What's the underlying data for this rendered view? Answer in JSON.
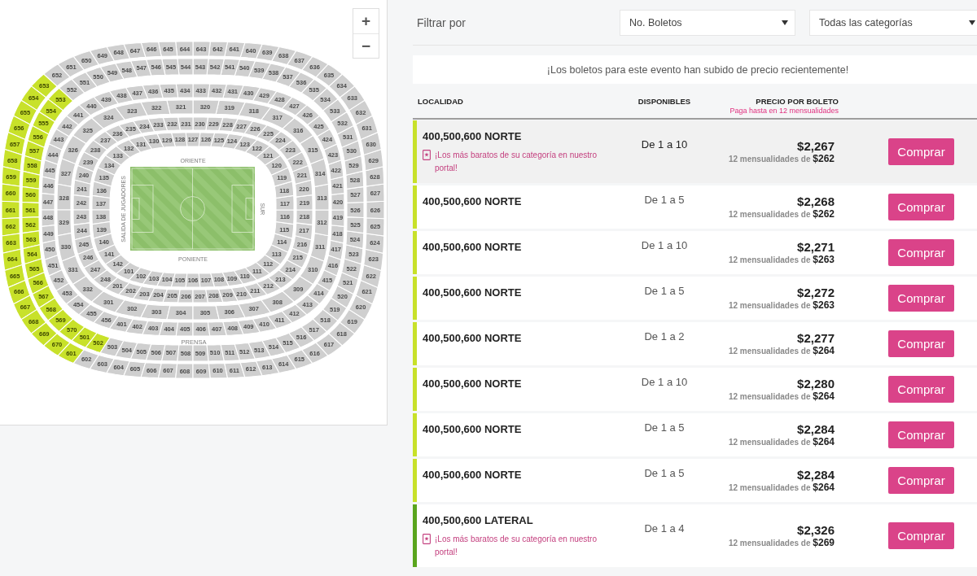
{
  "map": {
    "zoom_controls": [
      "+",
      "−"
    ],
    "stand_labels": [
      {
        "kind": "top",
        "text": "ORIENTE"
      },
      {
        "kind": "bottom",
        "text": "PONIENTE"
      },
      {
        "kind": "left",
        "text": "SALIDA DE JUGADORES"
      },
      {
        "kind": "right",
        "text": "SUR"
      },
      {
        "kind": "press",
        "text": "PRENSA"
      }
    ],
    "rings": [
      {
        "stands": [
          {
            "kind": "top",
            "sections": [
              {
                "label": "132",
                "highlighted": false
              },
              {
                "label": "131",
                "highlighted": false
              },
              {
                "label": "130",
                "highlighted": false
              },
              {
                "label": "129",
                "highlighted": false
              },
              {
                "label": "128",
                "highlighted": false
              },
              {
                "label": "127",
                "highlighted": false
              },
              {
                "label": "126",
                "highlighted": false
              },
              {
                "label": "125",
                "highlighted": false
              },
              {
                "label": "124",
                "highlighted": false
              },
              {
                "label": "123",
                "highlighted": false
              },
              {
                "label": "122",
                "highlighted": false
              }
            ]
          },
          {
            "kind": "left",
            "sections": [
              {
                "label": "133",
                "highlighted": false
              },
              {
                "label": "134",
                "highlighted": false
              },
              {
                "label": "135",
                "highlighted": false
              },
              {
                "label": "136",
                "highlighted": false
              },
              {
                "label": "137",
                "highlighted": false
              },
              {
                "label": "138",
                "highlighted": false
              },
              {
                "label": "139",
                "highlighted": false
              },
              {
                "label": "140",
                "highlighted": false
              },
              {
                "label": "141",
                "highlighted": false
              },
              {
                "label": "142",
                "highlighted": false
              }
            ]
          },
          {
            "kind": "right",
            "sections": [
              {
                "label": "121",
                "highlighted": false
              },
              {
                "label": "120",
                "highlighted": false
              },
              {
                "label": "119",
                "highlighted": false
              },
              {
                "label": "118",
                "highlighted": false
              },
              {
                "label": "117",
                "highlighted": false
              },
              {
                "label": "116",
                "highlighted": false
              },
              {
                "label": "115",
                "highlighted": false
              },
              {
                "label": "114",
                "highlighted": false
              },
              {
                "label": "113",
                "highlighted": false
              },
              {
                "label": "112",
                "highlighted": false
              }
            ]
          },
          {
            "kind": "bottom",
            "sections": [
              {
                "label": "101",
                "highlighted": false
              },
              {
                "label": "102",
                "highlighted": false
              },
              {
                "label": "103",
                "highlighted": false
              },
              {
                "label": "104",
                "highlighted": false
              },
              {
                "label": "105",
                "highlighted": false
              },
              {
                "label": "106",
                "highlighted": false
              },
              {
                "label": "107",
                "highlighted": false
              },
              {
                "label": "108",
                "highlighted": false
              },
              {
                "label": "109",
                "highlighted": false
              },
              {
                "label": "110",
                "highlighted": false
              },
              {
                "label": "111",
                "highlighted": false
              }
            ]
          }
        ]
      },
      {
        "stands": [
          {
            "kind": "top",
            "sections": [
              {
                "label": "238",
                "highlighted": false
              },
              {
                "label": "237",
                "highlighted": false
              },
              {
                "label": "236",
                "highlighted": false
              },
              {
                "label": "235",
                "highlighted": false
              },
              {
                "label": "234",
                "highlighted": false
              },
              {
                "label": "233",
                "highlighted": false
              },
              {
                "label": "232",
                "highlighted": false
              },
              {
                "label": "231",
                "highlighted": false
              },
              {
                "label": "230",
                "highlighted": false
              },
              {
                "label": "229",
                "highlighted": false
              },
              {
                "label": "228",
                "highlighted": false
              },
              {
                "label": "227",
                "highlighted": false
              },
              {
                "label": "226",
                "highlighted": false
              },
              {
                "label": "225",
                "highlighted": false
              },
              {
                "label": "224",
                "highlighted": false
              },
              {
                "label": "223",
                "highlighted": false
              }
            ]
          },
          {
            "kind": "left",
            "sections": [
              {
                "label": "239",
                "highlighted": false
              },
              {
                "label": "240",
                "highlighted": false
              },
              {
                "label": "241",
                "highlighted": false
              },
              {
                "label": "242",
                "highlighted": false
              },
              {
                "label": "243",
                "highlighted": false
              },
              {
                "label": "244",
                "highlighted": false
              },
              {
                "label": "245",
                "highlighted": false
              },
              {
                "label": "246",
                "highlighted": false
              },
              {
                "label": "247",
                "highlighted": false
              },
              {
                "label": "248",
                "highlighted": false
              }
            ]
          },
          {
            "kind": "right",
            "sections": [
              {
                "label": "222",
                "highlighted": false
              },
              {
                "label": "221",
                "highlighted": false
              },
              {
                "label": "220",
                "highlighted": false
              },
              {
                "label": "219",
                "highlighted": false
              },
              {
                "label": "218",
                "highlighted": false
              },
              {
                "label": "217",
                "highlighted": false
              },
              {
                "label": "216",
                "highlighted": false
              },
              {
                "label": "215",
                "highlighted": false
              },
              {
                "label": "214",
                "highlighted": false
              },
              {
                "label": "213",
                "highlighted": false
              }
            ]
          },
          {
            "kind": "bottom",
            "sections": [
              {
                "label": "201",
                "highlighted": false
              },
              {
                "label": "202",
                "highlighted": false
              },
              {
                "label": "203",
                "highlighted": false
              },
              {
                "label": "204",
                "highlighted": false
              },
              {
                "label": "205",
                "highlighted": false
              },
              {
                "label": "206",
                "highlighted": false
              },
              {
                "label": "207",
                "highlighted": false
              },
              {
                "label": "208",
                "highlighted": false
              },
              {
                "label": "209",
                "highlighted": false
              },
              {
                "label": "210",
                "highlighted": false
              },
              {
                "label": "211",
                "highlighted": false
              },
              {
                "label": "212",
                "highlighted": false
              }
            ]
          }
        ]
      },
      {
        "stands": [
          {
            "kind": "top",
            "sections": [
              {
                "label": "325",
                "highlighted": false
              },
              {
                "label": "324",
                "highlighted": false
              },
              {
                "label": "323",
                "highlighted": false
              },
              {
                "label": "322",
                "highlighted": false
              },
              {
                "label": "321",
                "highlighted": false
              },
              {
                "label": "320",
                "highlighted": false
              },
              {
                "label": "319",
                "highlighted": false
              },
              {
                "label": "318",
                "highlighted": false
              },
              {
                "label": "317",
                "highlighted": false
              }
            ]
          },
          {
            "kind": "left",
            "sections": [
              {
                "label": "326",
                "highlighted": false
              },
              {
                "label": "327",
                "highlighted": false
              },
              {
                "label": "328",
                "highlighted": false
              },
              {
                "label": "329",
                "highlighted": false
              },
              {
                "label": "330",
                "highlighted": false
              },
              {
                "label": "331",
                "highlighted": false
              },
              {
                "label": "332",
                "highlighted": false
              }
            ]
          },
          {
            "kind": "right",
            "sections": [
              {
                "label": "316",
                "highlighted": false
              },
              {
                "label": "315",
                "highlighted": false
              },
              {
                "label": "314",
                "highlighted": false
              },
              {
                "label": "313",
                "highlighted": false
              },
              {
                "label": "312",
                "highlighted": false
              },
              {
                "label": "311",
                "highlighted": false
              },
              {
                "label": "310",
                "highlighted": false
              },
              {
                "label": "309",
                "highlighted": false
              }
            ]
          },
          {
            "kind": "bottom",
            "sections": [
              {
                "label": "301",
                "highlighted": false
              },
              {
                "label": "302",
                "highlighted": false
              },
              {
                "label": "303",
                "highlighted": false
              },
              {
                "label": "304",
                "highlighted": false
              },
              {
                "label": "305",
                "highlighted": false
              },
              {
                "label": "306",
                "highlighted": false
              },
              {
                "label": "307",
                "highlighted": false
              },
              {
                "label": "308",
                "highlighted": false
              }
            ]
          }
        ]
      },
      {
        "stands": [
          {
            "kind": "top",
            "sections": [
              {
                "label": "444",
                "highlighted": false
              },
              {
                "label": "443",
                "highlighted": false
              },
              {
                "label": "442",
                "highlighted": false
              },
              {
                "label": "441",
                "highlighted": false
              },
              {
                "label": "440",
                "highlighted": false
              },
              {
                "label": "439",
                "highlighted": false
              },
              {
                "label": "438",
                "highlighted": false
              },
              {
                "label": "437",
                "highlighted": false
              },
              {
                "label": "436",
                "highlighted": false
              },
              {
                "label": "435",
                "highlighted": false
              },
              {
                "label": "434",
                "highlighted": false
              },
              {
                "label": "433",
                "highlighted": false
              },
              {
                "label": "432",
                "highlighted": false
              },
              {
                "label": "431",
                "highlighted": false
              },
              {
                "label": "430",
                "highlighted": false
              },
              {
                "label": "429",
                "highlighted": false
              },
              {
                "label": "428",
                "highlighted": false
              },
              {
                "label": "427",
                "highlighted": false
              }
            ]
          },
          {
            "kind": "left",
            "sections": [
              {
                "label": "445",
                "highlighted": false
              },
              {
                "label": "446",
                "highlighted": false
              },
              {
                "label": "447",
                "highlighted": false
              },
              {
                "label": "448",
                "highlighted": false
              },
              {
                "label": "449",
                "highlighted": false
              },
              {
                "label": "450",
                "highlighted": false
              },
              {
                "label": "451",
                "highlighted": false
              },
              {
                "label": "452",
                "highlighted": false
              },
              {
                "label": "453",
                "highlighted": false
              },
              {
                "label": "454",
                "highlighted": false
              },
              {
                "label": "455",
                "highlighted": false
              },
              {
                "label": "456",
                "highlighted": false
              }
            ]
          },
          {
            "kind": "right",
            "sections": [
              {
                "label": "426",
                "highlighted": false
              },
              {
                "label": "425",
                "highlighted": false
              },
              {
                "label": "424",
                "highlighted": false
              },
              {
                "label": "423",
                "highlighted": false
              },
              {
                "label": "422",
                "highlighted": false
              },
              {
                "label": "421",
                "highlighted": false
              },
              {
                "label": "420",
                "highlighted": false
              },
              {
                "label": "419",
                "highlighted": false
              },
              {
                "label": "418",
                "highlighted": false
              },
              {
                "label": "417",
                "highlighted": false
              },
              {
                "label": "416",
                "highlighted": false
              },
              {
                "label": "415",
                "highlighted": false
              },
              {
                "label": "414",
                "highlighted": false
              },
              {
                "label": "413",
                "highlighted": false
              },
              {
                "label": "412",
                "highlighted": false
              },
              {
                "label": "411",
                "highlighted": false
              }
            ]
          },
          {
            "kind": "bottom",
            "sections": [
              {
                "label": "401",
                "highlighted": false
              },
              {
                "label": "402",
                "highlighted": false
              },
              {
                "label": "403",
                "highlighted": false
              },
              {
                "label": "404",
                "highlighted": false
              },
              {
                "label": "405",
                "highlighted": false
              },
              {
                "label": "406",
                "highlighted": false
              },
              {
                "label": "407",
                "highlighted": false
              },
              {
                "label": "408",
                "highlighted": false
              },
              {
                "label": "409",
                "highlighted": false
              },
              {
                "label": "410",
                "highlighted": false
              }
            ]
          }
        ]
      },
      {
        "stands": [
          {
            "kind": "top",
            "sections": [
              {
                "label": "552",
                "highlighted": false
              },
              {
                "label": "551",
                "highlighted": false
              },
              {
                "label": "550",
                "highlighted": false
              },
              {
                "label": "549",
                "highlighted": false
              },
              {
                "label": "548",
                "highlighted": false
              },
              {
                "label": "547",
                "highlighted": false
              },
              {
                "label": "546",
                "highlighted": false
              },
              {
                "label": "545",
                "highlighted": false
              },
              {
                "label": "544",
                "highlighted": false
              },
              {
                "label": "543",
                "highlighted": false
              },
              {
                "label": "542",
                "highlighted": false
              },
              {
                "label": "541",
                "highlighted": false
              },
              {
                "label": "540",
                "highlighted": false
              },
              {
                "label": "539",
                "highlighted": false
              },
              {
                "label": "538",
                "highlighted": false
              },
              {
                "label": "537",
                "highlighted": false
              }
            ]
          },
          {
            "kind": "left",
            "sections": [
              {
                "label": "553",
                "highlighted": true
              },
              {
                "label": "554",
                "highlighted": true
              },
              {
                "label": "555",
                "highlighted": true
              },
              {
                "label": "556",
                "highlighted": true
              },
              {
                "label": "557",
                "highlighted": true
              },
              {
                "label": "558",
                "highlighted": true
              },
              {
                "label": "559",
                "highlighted": true
              },
              {
                "label": "560",
                "highlighted": true
              },
              {
                "label": "561",
                "highlighted": true
              },
              {
                "label": "562",
                "highlighted": true
              },
              {
                "label": "563",
                "highlighted": true
              },
              {
                "label": "564",
                "highlighted": true
              },
              {
                "label": "565",
                "highlighted": true
              },
              {
                "label": "566",
                "highlighted": true
              },
              {
                "label": "567",
                "highlighted": true
              },
              {
                "label": "568",
                "highlighted": true
              },
              {
                "label": "569",
                "highlighted": true
              },
              {
                "label": "570",
                "highlighted": true
              }
            ]
          },
          {
            "kind": "right",
            "sections": [
              {
                "label": "536",
                "highlighted": false
              },
              {
                "label": "535",
                "highlighted": false
              },
              {
                "label": "534",
                "highlighted": false
              },
              {
                "label": "533",
                "highlighted": false
              },
              {
                "label": "532",
                "highlighted": false
              },
              {
                "label": "531",
                "highlighted": false
              },
              {
                "label": "530",
                "highlighted": false
              },
              {
                "label": "529",
                "highlighted": false
              },
              {
                "label": "528",
                "highlighted": false
              },
              {
                "label": "527",
                "highlighted": false
              },
              {
                "label": "526",
                "highlighted": false
              },
              {
                "label": "525",
                "highlighted": false
              },
              {
                "label": "524",
                "highlighted": false
              },
              {
                "label": "523",
                "highlighted": false
              },
              {
                "label": "522",
                "highlighted": false
              },
              {
                "label": "521",
                "highlighted": false
              },
              {
                "label": "520",
                "highlighted": false
              },
              {
                "label": "519",
                "highlighted": false
              },
              {
                "label": "518",
                "highlighted": false
              },
              {
                "label": "517",
                "highlighted": false
              }
            ]
          },
          {
            "kind": "bottom",
            "sections": [
              {
                "label": "501",
                "highlighted": true
              },
              {
                "label": "502",
                "highlighted": true
              },
              {
                "label": "503",
                "highlighted": false
              },
              {
                "label": "504",
                "highlighted": false
              },
              {
                "label": "505",
                "highlighted": false
              },
              {
                "label": "506",
                "highlighted": false
              },
              {
                "label": "507",
                "highlighted": false
              },
              {
                "label": "508",
                "highlighted": false
              },
              {
                "label": "509",
                "highlighted": false
              },
              {
                "label": "510",
                "highlighted": false
              },
              {
                "label": "511",
                "highlighted": false
              },
              {
                "label": "512",
                "highlighted": false
              },
              {
                "label": "513",
                "highlighted": false
              },
              {
                "label": "514",
                "highlighted": false
              },
              {
                "label": "515",
                "highlighted": false
              },
              {
                "label": "516",
                "highlighted": false
              }
            ]
          }
        ]
      },
      {
        "stands": [
          {
            "kind": "top",
            "sections": [
              {
                "label": "652",
                "highlighted": false
              },
              {
                "label": "651",
                "highlighted": false
              },
              {
                "label": "650",
                "highlighted": false
              },
              {
                "label": "649",
                "highlighted": false
              },
              {
                "label": "648",
                "highlighted": false
              },
              {
                "label": "647",
                "highlighted": false
              },
              {
                "label": "646",
                "highlighted": false
              },
              {
                "label": "645",
                "highlighted": false
              },
              {
                "label": "644",
                "highlighted": false
              },
              {
                "label": "643",
                "highlighted": false
              },
              {
                "label": "642",
                "highlighted": false
              },
              {
                "label": "641",
                "highlighted": false
              },
              {
                "label": "640",
                "highlighted": false
              },
              {
                "label": "639",
                "highlighted": false
              },
              {
                "label": "638",
                "highlighted": false
              },
              {
                "label": "637",
                "highlighted": false
              }
            ]
          },
          {
            "kind": "left",
            "sections": [
              {
                "label": "653",
                "highlighted": true
              },
              {
                "label": "654",
                "highlighted": true
              },
              {
                "label": "655",
                "highlighted": true
              },
              {
                "label": "656",
                "highlighted": true
              },
              {
                "label": "657",
                "highlighted": true
              },
              {
                "label": "658",
                "highlighted": true
              },
              {
                "label": "659",
                "highlighted": true
              },
              {
                "label": "660",
                "highlighted": true
              },
              {
                "label": "661",
                "highlighted": true
              },
              {
                "label": "662",
                "highlighted": true
              },
              {
                "label": "663",
                "highlighted": true
              },
              {
                "label": "664",
                "highlighted": true
              },
              {
                "label": "665",
                "highlighted": true
              },
              {
                "label": "666",
                "highlighted": true
              },
              {
                "label": "667",
                "highlighted": true
              },
              {
                "label": "668",
                "highlighted": true
              },
              {
                "label": "669",
                "highlighted": true
              },
              {
                "label": "670",
                "highlighted": true
              }
            ]
          },
          {
            "kind": "right",
            "sections": [
              {
                "label": "636",
                "highlighted": false
              },
              {
                "label": "635",
                "highlighted": false
              },
              {
                "label": "634",
                "highlighted": false
              },
              {
                "label": "633",
                "highlighted": false
              },
              {
                "label": "632",
                "highlighted": false
              },
              {
                "label": "631",
                "highlighted": false
              },
              {
                "label": "630",
                "highlighted": false
              },
              {
                "label": "629",
                "highlighted": false
              },
              {
                "label": "628",
                "highlighted": false
              },
              {
                "label": "627",
                "highlighted": false
              },
              {
                "label": "626",
                "highlighted": false
              },
              {
                "label": "625",
                "highlighted": false
              },
              {
                "label": "624",
                "highlighted": false
              },
              {
                "label": "623",
                "highlighted": false
              },
              {
                "label": "622",
                "highlighted": false
              },
              {
                "label": "621",
                "highlighted": false
              },
              {
                "label": "620",
                "highlighted": false
              },
              {
                "label": "619",
                "highlighted": false
              },
              {
                "label": "618",
                "highlighted": false
              },
              {
                "label": "617",
                "highlighted": false
              }
            ]
          },
          {
            "kind": "bottom",
            "sections": [
              {
                "label": "601",
                "highlighted": true
              },
              {
                "label": "602",
                "highlighted": false
              },
              {
                "label": "603",
                "highlighted": false
              },
              {
                "label": "604",
                "highlighted": false
              },
              {
                "label": "605",
                "highlighted": false
              },
              {
                "label": "606",
                "highlighted": false
              },
              {
                "label": "607",
                "highlighted": false
              },
              {
                "label": "608",
                "highlighted": false
              },
              {
                "label": "609",
                "highlighted": false
              },
              {
                "label": "610",
                "highlighted": false
              },
              {
                "label": "611",
                "highlighted": false
              },
              {
                "label": "612",
                "highlighted": false
              },
              {
                "label": "613",
                "highlighted": false
              },
              {
                "label": "614",
                "highlighted": false
              },
              {
                "label": "615",
                "highlighted": false
              },
              {
                "label": "616",
                "highlighted": false
              }
            ]
          }
        ]
      }
    ]
  },
  "filters": {
    "label": "Filtrar por",
    "selects": [
      {
        "value": "No. Boletos"
      },
      {
        "value": "Todas las categorías"
      }
    ]
  },
  "notice": "¡Los boletos para este evento han subido de precio recientemente!",
  "table": {
    "columns": [
      {
        "kind": "location",
        "label": "LOCALIDAD"
      },
      {
        "kind": "available",
        "label": "DISPONIBLES"
      },
      {
        "kind": "price",
        "label": "PRECIO POR BOLETO",
        "note": "Paga hasta en 12 mensualidades"
      }
    ],
    "rows": [
      {
        "location": "400,500,600 NORTE",
        "color": "#c8e12a",
        "highlighted": true,
        "badge": "¡Los más baratos de su categoría en nuestro portal!",
        "available": "De 1 a 10",
        "price": "$2,267",
        "installments": "12 mensualidades de **$262**",
        "action": "Comprar"
      },
      {
        "location": "400,500,600 NORTE",
        "color": "#c8e12a",
        "highlighted": false,
        "available": "De 1 a 5",
        "price": "$2,268",
        "installments": "12 mensualidades de **$262**",
        "action": "Comprar"
      },
      {
        "location": "400,500,600 NORTE",
        "color": "#c8e12a",
        "highlighted": false,
        "available": "De 1 a 10",
        "price": "$2,271",
        "installments": "12 mensualidades de **$263**",
        "action": "Comprar"
      },
      {
        "location": "400,500,600 NORTE",
        "color": "#c8e12a",
        "highlighted": false,
        "available": "De 1 a 5",
        "price": "$2,272",
        "installments": "12 mensualidades de **$263**",
        "action": "Comprar"
      },
      {
        "location": "400,500,600 NORTE",
        "color": "#c8e12a",
        "highlighted": false,
        "available": "De 1 a 2",
        "price": "$2,277",
        "installments": "12 mensualidades de **$264**",
        "action": "Comprar"
      },
      {
        "location": "400,500,600 NORTE",
        "color": "#c8e12a",
        "highlighted": false,
        "available": "De 1 a 10",
        "price": "$2,280",
        "installments": "12 mensualidades de **$264**",
        "action": "Comprar"
      },
      {
        "location": "400,500,600 NORTE",
        "color": "#c8e12a",
        "highlighted": false,
        "available": "De 1 a 5",
        "price": "$2,284",
        "installments": "12 mensualidades de **$264**",
        "action": "Comprar"
      },
      {
        "location": "400,500,600 NORTE",
        "color": "#c8e12a",
        "highlighted": false,
        "available": "De 1 a 5",
        "price": "$2,284",
        "installments": "12 mensualidades de **$264**",
        "action": "Comprar"
      },
      {
        "location": "400,500,600 LATERAL",
        "color": "#5aa51e",
        "highlighted": false,
        "badge": "¡Los más baratos de su categoría en nuestro portal!",
        "available": "De 1 a 4",
        "price": "$2,326",
        "installments": "12 mensualidades de **$269**",
        "action": "Comprar"
      }
    ]
  }
}
